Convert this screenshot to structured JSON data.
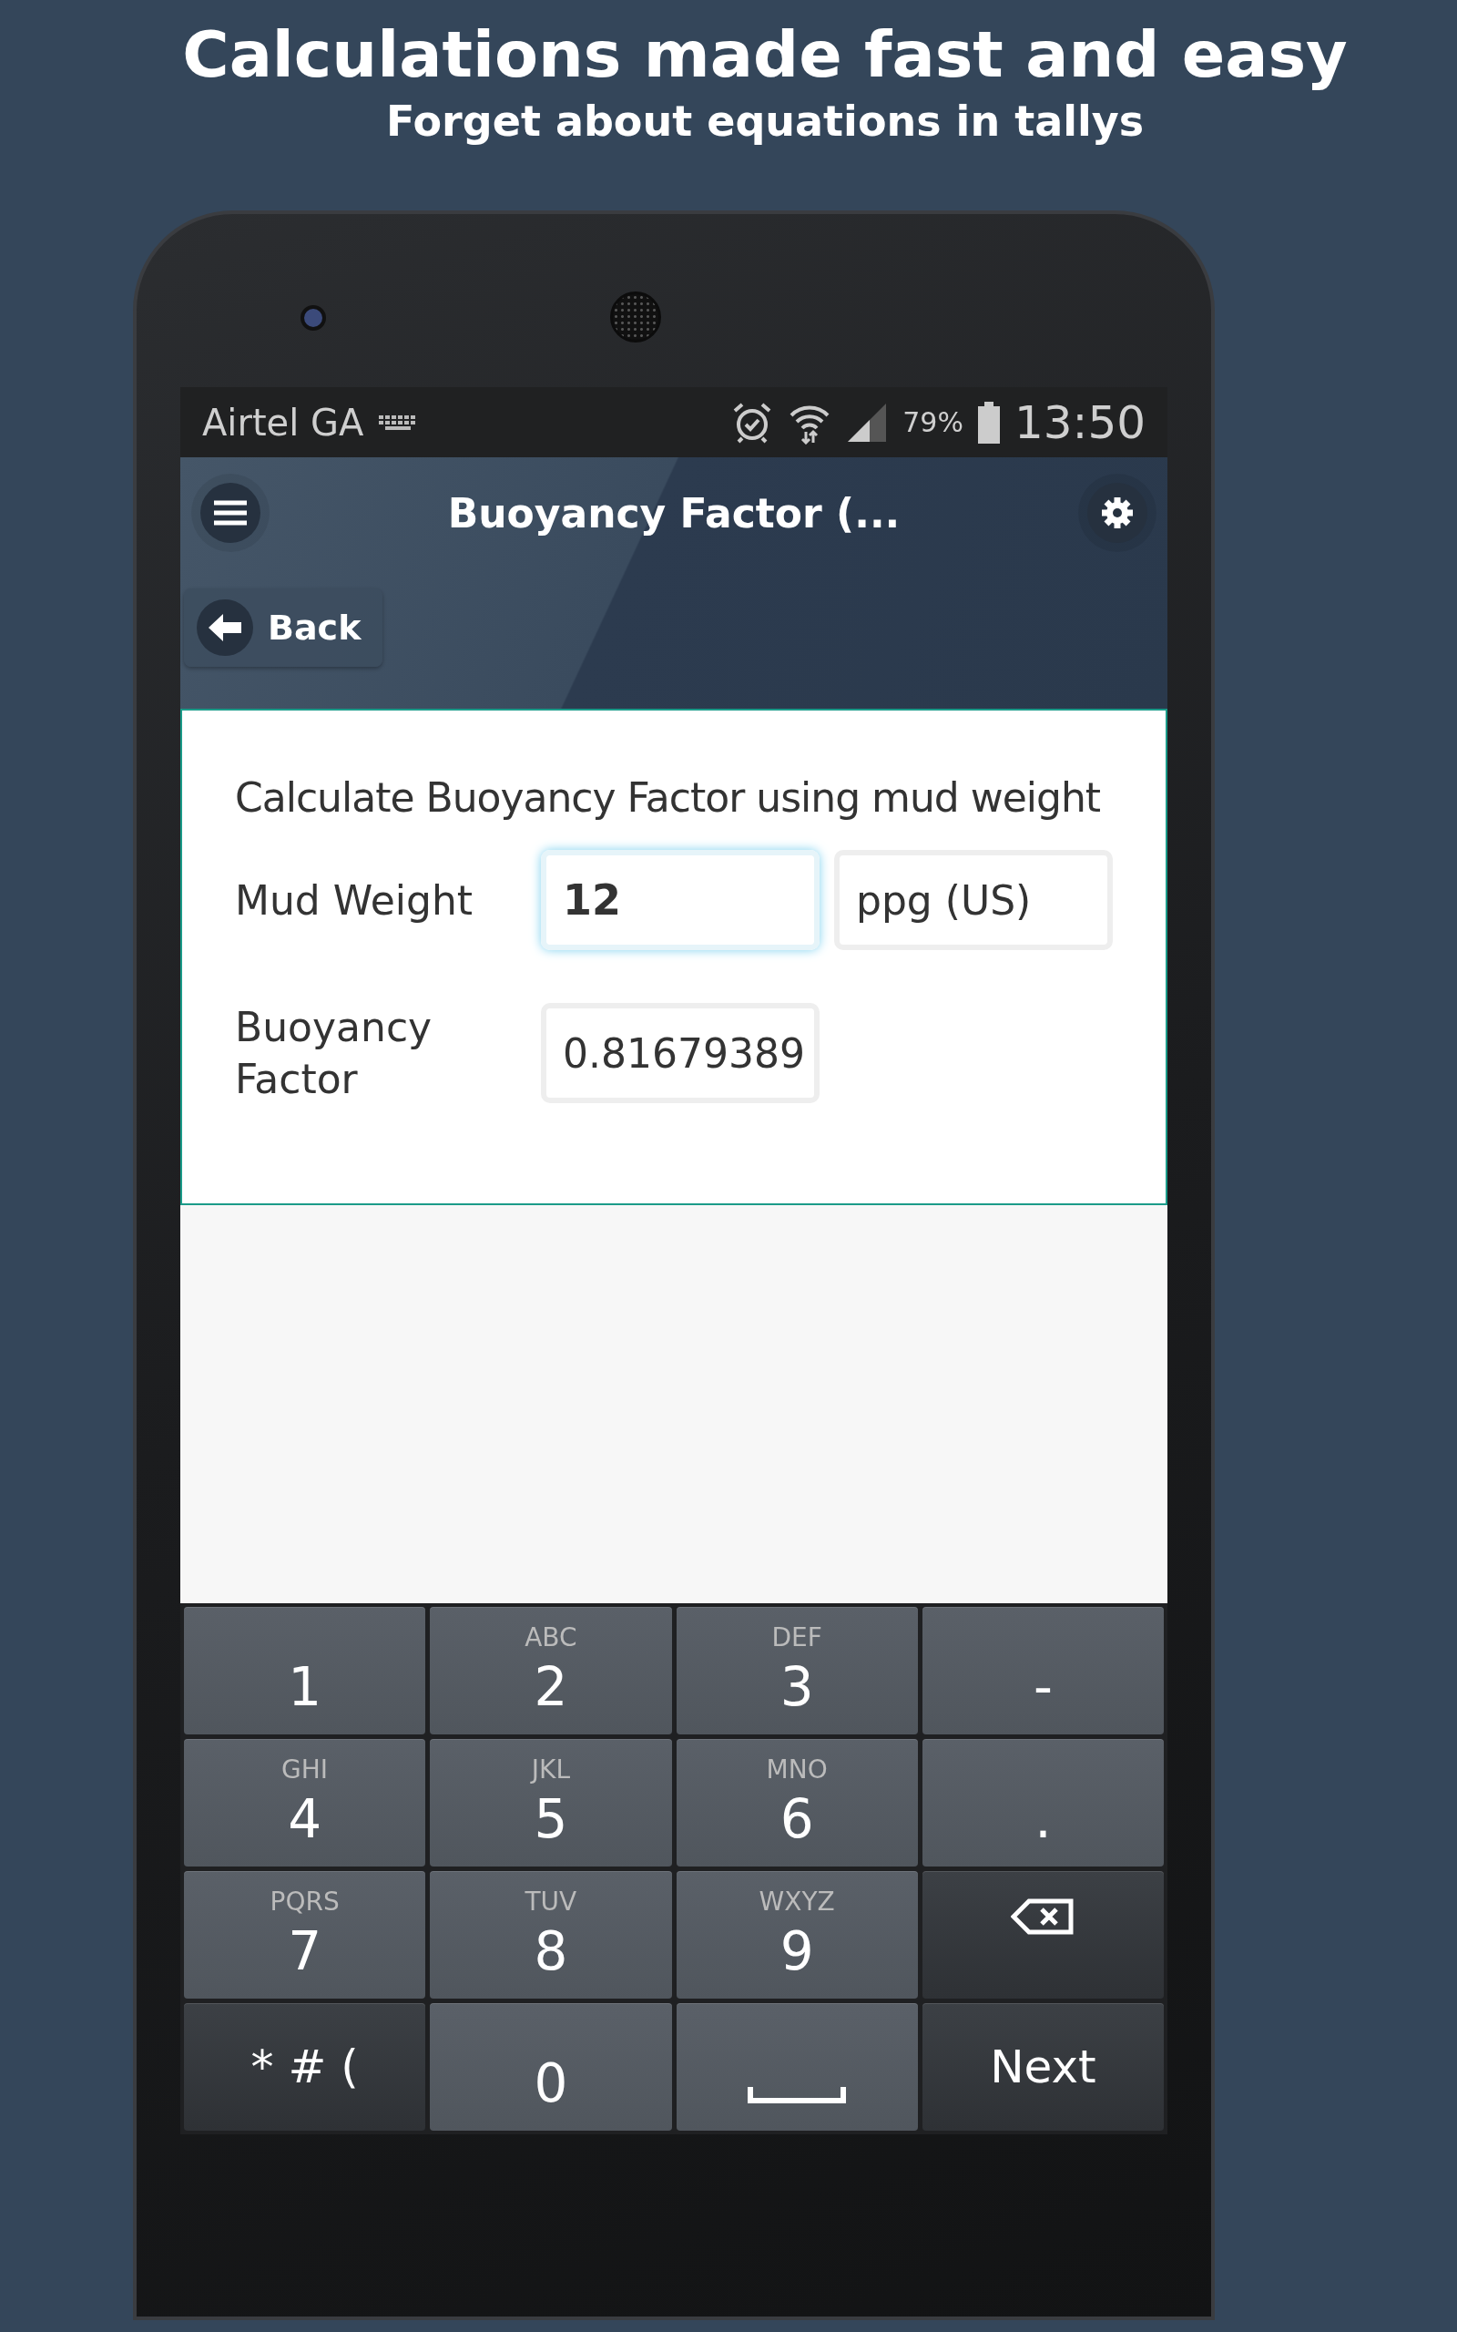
{
  "promo": {
    "headline": "Calculations made fast and easy",
    "subheadline": "Forget about equations in tallys"
  },
  "status_bar": {
    "carrier": "Airtel GA",
    "battery": "79%",
    "time": "13:50"
  },
  "app_bar": {
    "title": "Buoyancy Factor (...",
    "back": "Back"
  },
  "form": {
    "heading": "Calculate Buoyancy Factor using mud weight",
    "rows": [
      {
        "label": "Mud Weight",
        "value": "12",
        "focused": true,
        "unit": "ppg (US)"
      },
      {
        "label": "Buoyancy Factor",
        "value": "0.81679389",
        "focused": false
      }
    ]
  },
  "keyboard": {
    "keys": [
      {
        "kind": "key",
        "main": "1"
      },
      {
        "kind": "key",
        "main": "2",
        "letters": "ABC"
      },
      {
        "kind": "key",
        "main": "3",
        "letters": "DEF"
      },
      {
        "kind": "key",
        "main": "-"
      },
      {
        "kind": "key",
        "main": "4",
        "letters": "GHI"
      },
      {
        "kind": "key",
        "main": "5",
        "letters": "JKL"
      },
      {
        "kind": "key",
        "main": "6",
        "letters": "MNO"
      },
      {
        "kind": "key",
        "main": "."
      },
      {
        "kind": "key",
        "main": "7",
        "letters": "PQRS"
      },
      {
        "kind": "key",
        "main": "8",
        "letters": "TUV"
      },
      {
        "kind": "key",
        "main": "9",
        "letters": "WXYZ"
      },
      {
        "kind": "backspace"
      },
      {
        "kind": "function",
        "main": "* # ("
      },
      {
        "kind": "key",
        "main": "0"
      },
      {
        "kind": "space"
      },
      {
        "kind": "function",
        "main": "Next"
      }
    ]
  }
}
